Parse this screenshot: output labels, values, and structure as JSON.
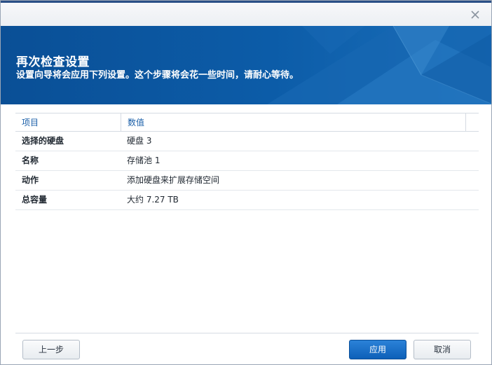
{
  "dialog": {
    "title": "再次检查设置",
    "subtitle": "设置向导将会应用下列设置。这个步骤将会花一些时间，请耐心等待。"
  },
  "grid": {
    "columns": [
      "项目",
      "数值"
    ],
    "rows": [
      {
        "key": "选择的硬盘",
        "value": "硬盘 3"
      },
      {
        "key": "名称",
        "value": "存储池 1"
      },
      {
        "key": "动作",
        "value": "添加硬盘来扩展存储空间"
      },
      {
        "key": "总容量",
        "value": "大约 7.27 TB"
      }
    ]
  },
  "buttons": {
    "back": "上一步",
    "apply": "应用",
    "cancel": "取消"
  },
  "icons": {
    "close": "close-icon"
  },
  "colors": {
    "banner": "#0c5ca8",
    "accent": "#1a5fa8",
    "primary_button": "#0d60b8"
  }
}
